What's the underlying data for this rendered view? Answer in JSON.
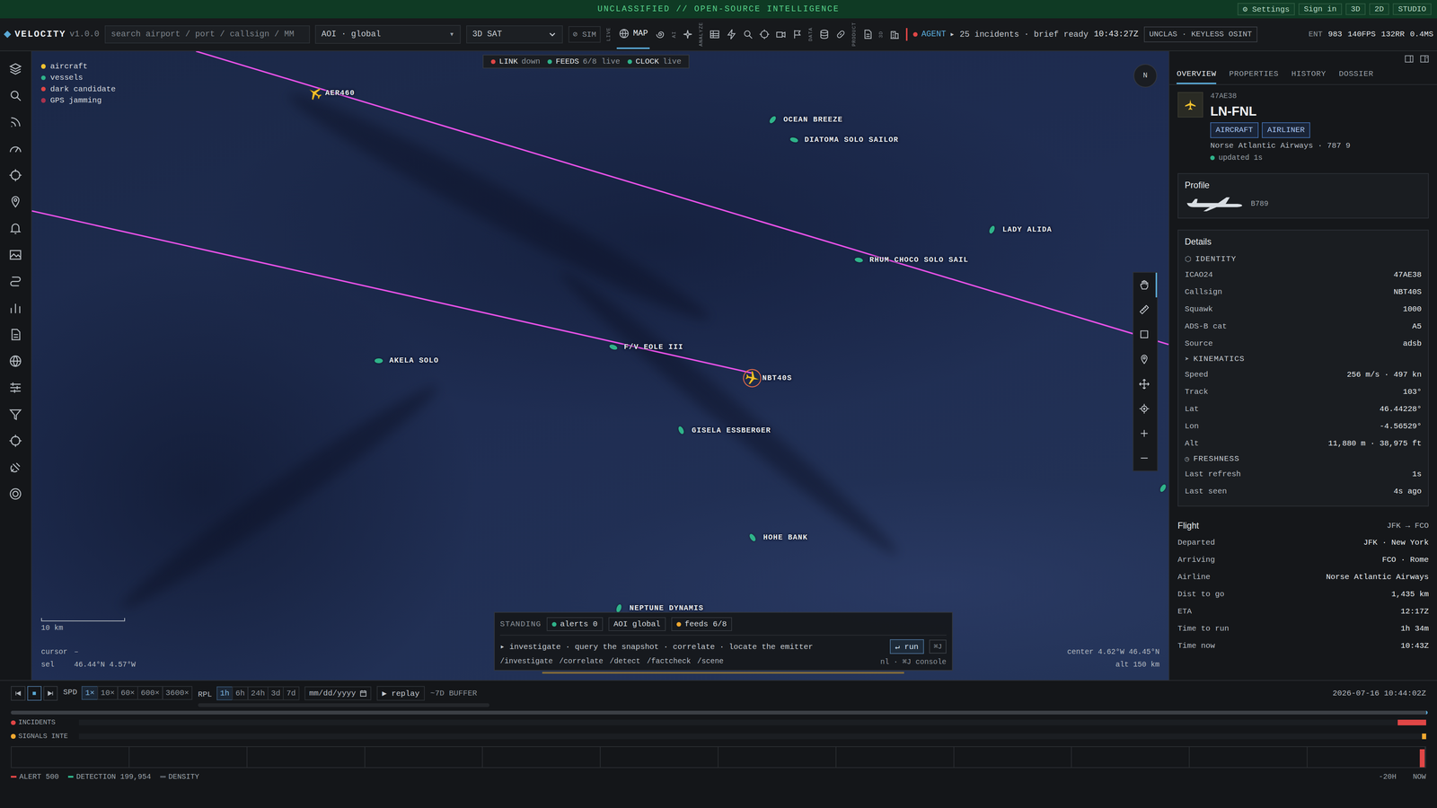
{
  "banner": {
    "text": "UNCLASSIFIED // OPEN-SOURCE INTELLIGENCE",
    "links": [
      "⚙ Settings",
      "Sign in",
      "3D",
      "2D",
      "STUDIO"
    ]
  },
  "toolbar": {
    "logo": "VELOCITY",
    "version": "v1.0.0",
    "search": {
      "placeholder": "search airport / port / callsign / MM"
    },
    "aoi": {
      "label": "AOI · global",
      "caret": "▾"
    },
    "view": "3D SAT",
    "sim": "⊘ SIM",
    "groups": [
      "LIVE",
      "AI",
      "ANALYZE",
      "DATA",
      "PRODUCT",
      "3D"
    ],
    "tab": {
      "label": "MAP",
      "selected": true
    },
    "agent": {
      "label": "AGENT",
      "text": "▸ 25 incidents · brief ready"
    },
    "clock": "10:43:27Z",
    "classification": "UNCLAS · KEYLESS OSINT",
    "stats": [
      "ENT",
      "983",
      "140FPS",
      "132RR",
      "0.4MS"
    ]
  },
  "map": {
    "legend": [
      {
        "label": "aircraft",
        "color": "#f2c230"
      },
      {
        "label": "vessels",
        "color": "#2fb38a"
      },
      {
        "label": "dark candidate",
        "color": "#e04646"
      },
      {
        "label": "GPS jamming",
        "color": "#a8324e"
      }
    ],
    "status": [
      {
        "label": "LINK",
        "value": "down",
        "color": "#e04646"
      },
      {
        "label": "FEEDS",
        "value": "6/8 live",
        "color": "#2fb38a"
      },
      {
        "label": "CLOCK",
        "value": "live",
        "color": "#2fb38a"
      }
    ],
    "compass": "N",
    "aircraft": [
      {
        "callsign": "AER460",
        "selected": false
      },
      {
        "callsign": "NBT40S",
        "selected": true
      }
    ],
    "vessels": [
      "OCEAN BREEZE",
      "DIATOMA SOLO SAILOR",
      "LADY ALIDA",
      "RHUM CHOCO SOLO SAIL",
      "F/V EOLE III",
      "AKELA SOLO",
      "GISELA ESSBERGER",
      "HOHE BANK",
      "NEPTUNE DYNAMIS"
    ],
    "tools": [
      {
        "selected": true
      },
      {
        "selected": false
      },
      {
        "selected": false
      },
      {
        "selected": false
      },
      {
        "selected": false
      },
      {
        "selected": false
      },
      {
        "selected": false
      },
      {
        "selected": false
      }
    ],
    "scale": "10 km",
    "cursor": {
      "label": "cursor",
      "value": "–"
    },
    "selection": {
      "label": "sel",
      "value": "46.44°N 4.57°W"
    },
    "center": "center 4.62°W 46.45°N",
    "altitude": "alt 150 km"
  },
  "command": {
    "title": "STANDING",
    "chips": [
      {
        "label": "alerts 0",
        "color": "#2fb38a"
      },
      {
        "label": "AOI global"
      },
      {
        "label": "feeds 6/8",
        "color": "#f0a830"
      }
    ],
    "prompt": "▸ investigate · query the snapshot · correlate · locate the emitter",
    "run": "↵ run",
    "shortcut": "⌘J",
    "commands": [
      "/investigate",
      "/correlate",
      "/detect",
      "/factcheck",
      "/scene"
    ],
    "hint": "nl · ⌘J console"
  },
  "panel": {
    "tabs": [
      {
        "label": "OVERVIEW",
        "selected": true
      },
      {
        "label": "PROPERTIES",
        "selected": false
      },
      {
        "label": "HISTORY",
        "selected": false
      },
      {
        "label": "DOSSIER",
        "selected": false
      }
    ],
    "entity": {
      "id": "47AE38",
      "name": "LN-FNL",
      "badges": [
        "AIRCRAFT",
        "AIRLINER"
      ],
      "subtitle": "Norse Atlantic Airways · 787 9",
      "updated": "updated 1s"
    },
    "profile": {
      "title": "Profile",
      "type": "B789"
    },
    "details": {
      "title": "Details",
      "sections": [
        {
          "title": "IDENTITY",
          "icon": "⬡",
          "rows": [
            [
              "ICAO24",
              "47AE38"
            ],
            [
              "Callsign",
              "NBT40S"
            ],
            [
              "Squawk",
              "1000"
            ],
            [
              "ADS-B cat",
              "A5"
            ],
            [
              "Source",
              "adsb"
            ]
          ]
        },
        {
          "title": "KINEMATICS",
          "icon": "➤",
          "rows": [
            [
              "Speed",
              "256 m/s · 497 kn"
            ],
            [
              "Track",
              "103°"
            ],
            [
              "Lat",
              "46.44228°"
            ],
            [
              "Lon",
              "-4.56529°"
            ],
            [
              "Alt",
              "11,880 m · 38,975 ft"
            ]
          ]
        },
        {
          "title": "FRESHNESS",
          "icon": "◷",
          "rows": [
            [
              "Last refresh",
              "1s"
            ],
            [
              "Last seen",
              "4s ago"
            ]
          ]
        }
      ]
    },
    "flight": {
      "title": "Flight",
      "route": "JFK → FCO",
      "rows": [
        [
          "Departed",
          "JFK · New York"
        ],
        [
          "Arriving",
          "FCO · Rome"
        ],
        [
          "Airline",
          "Norse Atlantic Airways"
        ],
        [
          "Dist to go",
          "1,435 km"
        ],
        [
          "ETA",
          "12:17Z"
        ],
        [
          "Time to run",
          "1h 34m"
        ],
        [
          "Time now",
          "10:43Z"
        ]
      ]
    }
  },
  "timeline": {
    "speed": {
      "label": "SPD",
      "options": [
        {
          "label": "1×",
          "selected": true
        },
        {
          "label": "10×",
          "selected": false
        },
        {
          "label": "60×",
          "selected": false
        },
        {
          "label": "600×",
          "selected": false
        },
        {
          "label": "3600×",
          "selected": false
        }
      ]
    },
    "replay": {
      "label": "RPL",
      "options": [
        {
          "label": "1h",
          "selected": true
        },
        {
          "label": "6h",
          "selected": false
        },
        {
          "label": "24h",
          "selected": false
        },
        {
          "label": "3d",
          "selected": false
        },
        {
          "label": "7d",
          "selected": false
        }
      ]
    },
    "date": "mm/dd/yyyy",
    "button": "▶ replay",
    "buffer": "~7D BUFFER",
    "time": "2026-07-16 10:44:02Z",
    "scrubber": {
      "level": 1
    },
    "tracks": [
      {
        "label": "INCIDENTS",
        "color": "#e04646",
        "level": 0.021
      },
      {
        "label": "SIGNALS INTE",
        "color": "#f0a830",
        "level": 0.003
      }
    ],
    "histogram": [
      0,
      0,
      0,
      0,
      0,
      0,
      0,
      0,
      0,
      0,
      0,
      0.9
    ],
    "legend": [
      {
        "label": "ALERT 500",
        "color": "#e04646"
      },
      {
        "label": "DETECTION 199,954",
        "color": "#2fb38a"
      },
      {
        "label": "DENSITY",
        "color": "#555b62"
      }
    ],
    "axis": [
      "-20H",
      "NOW"
    ]
  }
}
